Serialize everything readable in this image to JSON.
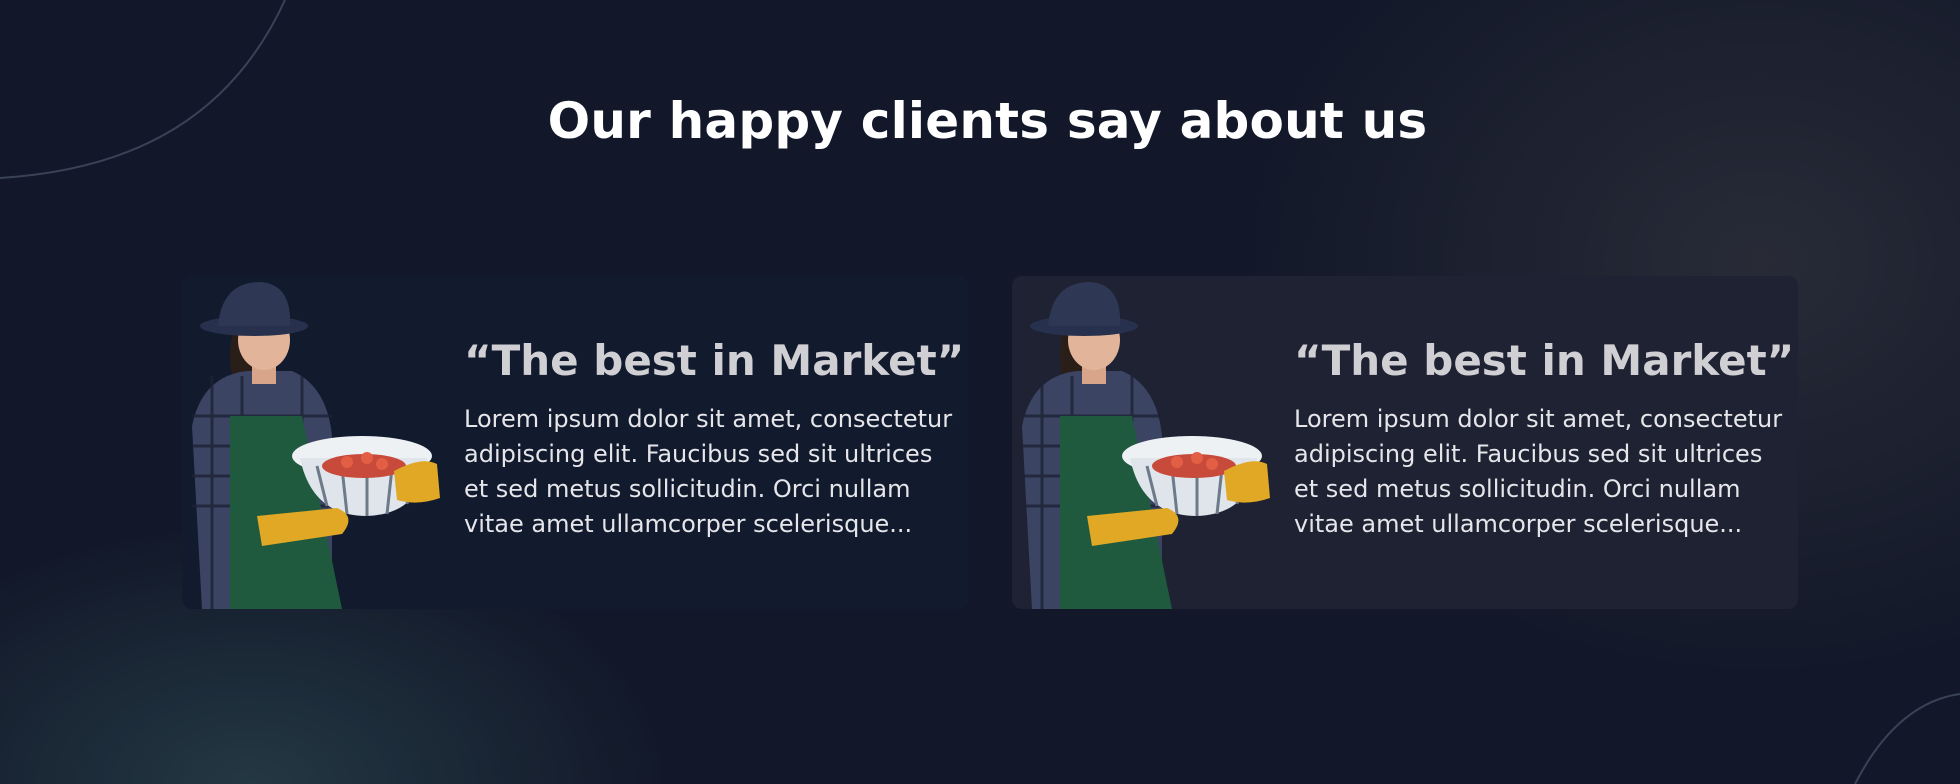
{
  "section": {
    "title": "Our happy clients say about us"
  },
  "testimonials": [
    {
      "quote": "“The best in Market”",
      "body": "Lorem ipsum dolor sit amet, consectetur adipiscing elit. Faucibus sed sit ultrices et sed metus sollicitudin. Orci nullam vitae amet ullamcorper scelerisque...",
      "photo_icon": "farmer-woman-with-strawberry-basket"
    },
    {
      "quote": "“The best in Market”",
      "body": "Lorem ipsum dolor sit amet, consectetur adipiscing elit. Faucibus sed sit ultrices et sed metus sollicitudin. Orci nullam vitae amet ullamcorper scelerisque...",
      "photo_icon": "farmer-woman-with-strawberry-basket"
    }
  ],
  "colors": {
    "background": "#121829",
    "card_highlight": "#1e2232",
    "apron": "#1f5a3e",
    "glove": "#e0a824"
  }
}
